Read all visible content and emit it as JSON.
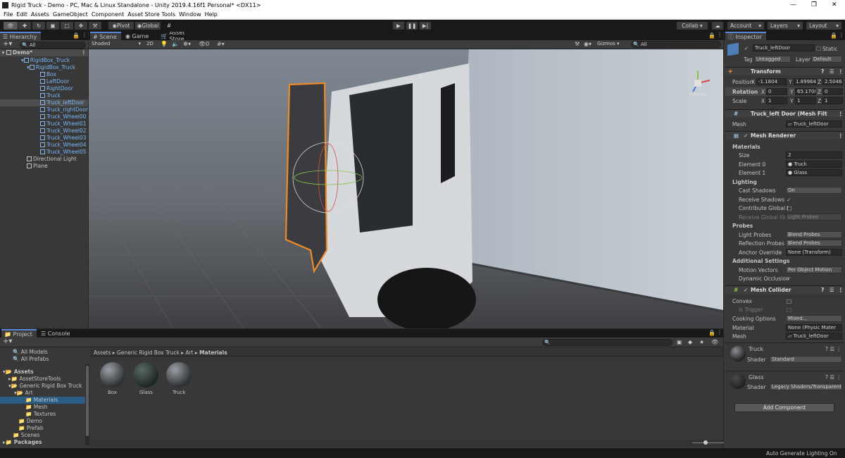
{
  "title": "Rigid Truck - Demo - PC, Mac & Linux Standalone - Unity 2019.4.16f1 Personal* <DX11>",
  "menu": [
    "File",
    "Edit",
    "Assets",
    "GameObject",
    "Component",
    "Asset Store Tools",
    "Window",
    "Help"
  ],
  "toolbar": {
    "pivot": "Pivot",
    "global": "Global",
    "collab": "Collab ▾",
    "account": "Account",
    "layers": "Layers",
    "layout": "Layout"
  },
  "hierarchy": {
    "tab": "Hierarchy",
    "search": "All",
    "scene": "Demo*",
    "items": [
      "RigidBox_Truck",
      "RigidBox_Truck",
      "Box",
      "LeftDoor",
      "RightDoor",
      "Truck",
      "Truck_leftDoor",
      "Truck_rightDoor",
      "Truck_Wheel00",
      "Truck_Wheel01",
      "Truck_Wheel02",
      "Truck_Wheel03",
      "Truck_Wheel04",
      "Truck_Wheel05",
      "Directional Light",
      "Plane"
    ]
  },
  "scene": {
    "tabs": [
      "Scene",
      "Game",
      "Asset Store"
    ],
    "shading": "Shaded",
    "mode2d": "2D",
    "gizmos": "Gizmos",
    "search": "All",
    "persp": "←Persp",
    "fx": "0"
  },
  "project": {
    "tabs": [
      "Project",
      "Console"
    ],
    "favorites": [
      "All Models",
      "All Prefabs"
    ],
    "tree": [
      "Assets",
      "AssetStoreTools",
      "Generic Rigid Box Truck",
      "Art",
      "Materials",
      "Mesh",
      "Textures",
      "Demo",
      "Prefab",
      "Scenes",
      "Packages"
    ],
    "breadcrumb": [
      "Assets",
      "Generic Rigid Box Truck",
      "Art",
      "Materials"
    ],
    "assets": [
      "Box",
      "Glass",
      "Truck"
    ]
  },
  "inspector": {
    "tab": "Inspector",
    "name": "Truck_leftDoor",
    "static": "Static",
    "tag_label": "Tag",
    "tag": "Untagged",
    "layer_label": "Layer",
    "layer": "Default",
    "transform": {
      "title": "Transform",
      "rows": [
        {
          "label": "Position",
          "x": "-1.1804",
          "y": "1.89964",
          "z": "2.50464"
        },
        {
          "label": "Rotation",
          "x": "0",
          "y": "65.1700",
          "z": "0"
        },
        {
          "label": "Scale",
          "x": "1",
          "y": "1",
          "z": "1"
        }
      ]
    },
    "meshfilter": {
      "title": "Truck_left Door (Mesh Filt",
      "mesh_label": "Mesh",
      "mesh": "Truck_leftDoor"
    },
    "renderer": {
      "title": "Mesh Renderer",
      "materials": "Materials",
      "size_label": "Size",
      "size": "2",
      "el0_label": "Element 0",
      "el0": "Truck",
      "el1_label": "Element 1",
      "el1": "Glass",
      "lighting": "Lighting",
      "cast_label": "Cast Shadows",
      "cast": "On",
      "recv_label": "Receive Shadows",
      "contrib_label": "Contribute Global I",
      "recvgi_label": "Receive Global Illu",
      "recvgi": "Light Probes",
      "probes": "Probes",
      "lp_label": "Light Probes",
      "lp": "Blend Probes",
      "rp_label": "Reflection Probes",
      "rp": "Blend Probes",
      "anchor_label": "Anchor Override",
      "anchor": "None (Transform)",
      "additional": "Additional Settings",
      "mv_label": "Motion Vectors",
      "mv": "Per Object Motion",
      "dyn_label": "Dynamic Occlusion"
    },
    "collider": {
      "title": "Mesh Collider",
      "convex": "Convex",
      "trigger": "Is Trigger",
      "cooking_label": "Cooking Options",
      "cooking": "Mixed...",
      "material_label": "Material",
      "material": "None (Physic Mater",
      "mesh_label": "Mesh",
      "mesh": "Truck_leftDoor"
    },
    "mat1": {
      "name": "Truck",
      "shader_label": "Shader",
      "shader": "Standard"
    },
    "mat2": {
      "name": "Glass",
      "shader_label": "Shader",
      "shader": "Legacy Shaders/Transparent"
    },
    "add_component": "Add Component"
  },
  "status": "Auto Generate Lighting On",
  "colors": {
    "accent": "#5a8ad8",
    "selection": "#2c5d87",
    "outline": "#f08a24"
  }
}
